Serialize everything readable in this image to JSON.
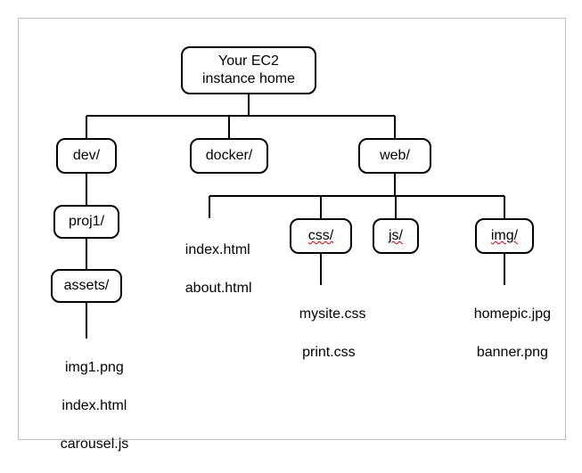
{
  "root": {
    "line1": "Your EC2",
    "line2": "instance home"
  },
  "dev": {
    "label": "dev/"
  },
  "docker": {
    "label": "docker/"
  },
  "web": {
    "label": "web/"
  },
  "proj1": {
    "label": "proj1/"
  },
  "assets": {
    "label": "assets/"
  },
  "css": {
    "label": "css/"
  },
  "js": {
    "label": "js/"
  },
  "img": {
    "label": "img/"
  },
  "web_files": {
    "file1": "index.html",
    "file2": "about.html"
  },
  "css_files": {
    "file1": "mysite.css",
    "file2": "print.css"
  },
  "img_files": {
    "file1": "homepic.jpg",
    "file2": "banner.png"
  },
  "assets_files": {
    "file1": "img1.png",
    "file2": "index.html",
    "file3": "carousel.js"
  }
}
